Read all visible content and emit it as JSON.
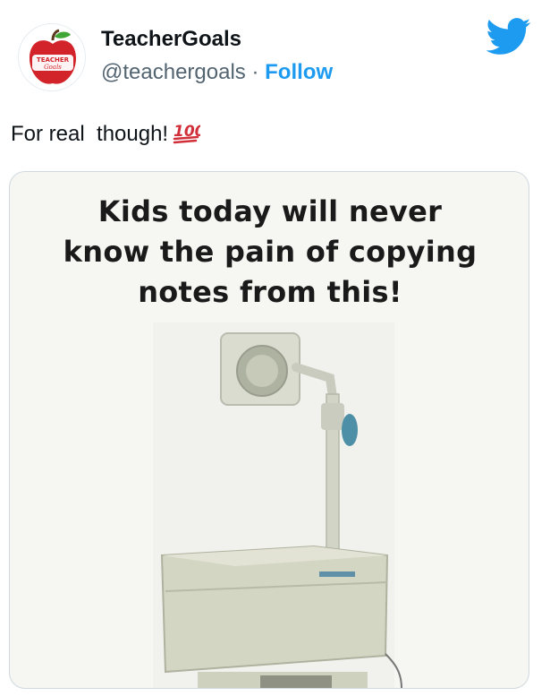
{
  "tweet": {
    "author_name": "TeacherGoals",
    "handle": "@teachergoals",
    "separator": " · ",
    "follow_label": "Follow",
    "text": "For real  though!",
    "emoji": "100-emoji",
    "avatar_logo_text_1": "TEACHER",
    "avatar_logo_text_2": "Goals"
  },
  "media": {
    "caption_lines": [
      "Kids today will never",
      "know the pain of copying",
      "notes from this!"
    ],
    "photo_subject": "overhead-projector"
  },
  "colors": {
    "twitter_blue": "#1d9bf0",
    "name_text": "#0f1419",
    "handle_text": "#536471",
    "apple_red": "#d3232a",
    "emoji_red": "#d1303a"
  }
}
